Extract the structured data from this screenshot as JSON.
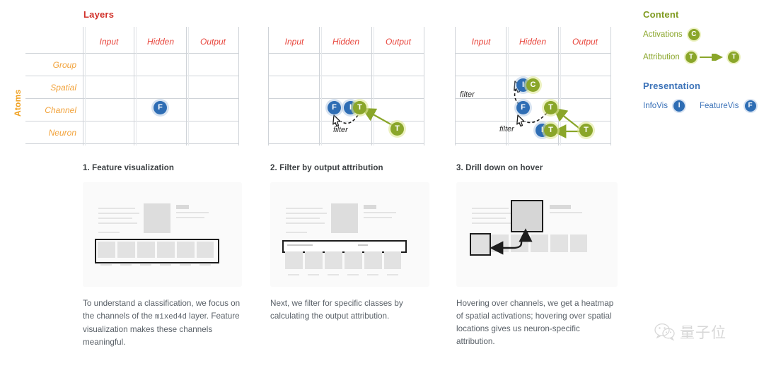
{
  "matrix": {
    "layers_title": "Layers",
    "atoms_title": "Atoms",
    "columns": [
      "Input",
      "Hidden",
      "Output"
    ],
    "rows": [
      "Group",
      "Spatial",
      "Channel",
      "Neuron"
    ],
    "filter_label": "filter"
  },
  "panel1": {
    "badges": [
      {
        "letter": "F",
        "kind": "blue",
        "row": "Channel",
        "col": "Hidden"
      }
    ]
  },
  "panel2": {
    "badges": [
      {
        "letter": "F",
        "kind": "blue",
        "row": "Channel",
        "col": "Hidden"
      },
      {
        "letter": "I",
        "kind": "blue",
        "row": "Channel",
        "col": "Hidden"
      },
      {
        "letter": "T",
        "kind": "green",
        "row": "Channel",
        "col": "Hidden"
      },
      {
        "letter": "T",
        "kind": "green",
        "row": "Neuron",
        "col": "Output"
      }
    ],
    "filter_label": "filter"
  },
  "panel3": {
    "badges": [
      {
        "letter": "I",
        "kind": "blue",
        "row": "Spatial",
        "col": "Hidden"
      },
      {
        "letter": "C",
        "kind": "green",
        "row": "Spatial",
        "col": "Hidden"
      },
      {
        "letter": "F",
        "kind": "blue",
        "row": "Channel",
        "col": "Hidden"
      },
      {
        "letter": "T",
        "kind": "green",
        "row": "Channel",
        "col": "Output"
      },
      {
        "letter": "I",
        "kind": "blue",
        "row": "Neuron",
        "col": "Output"
      },
      {
        "letter": "T",
        "kind": "green",
        "row": "Neuron",
        "col": "Output"
      },
      {
        "letter": "T",
        "kind": "green",
        "row": "Neuron",
        "col": "Output"
      }
    ],
    "filter_label_top": "filter",
    "filter_label_bottom": "filter"
  },
  "legend": {
    "content_heading": "Content",
    "activations_label": "Activations",
    "activations_badge": "C",
    "attribution_label": "Attribution",
    "attribution_badge_from": "T",
    "attribution_badge_to": "T",
    "presentation_heading": "Presentation",
    "infovis_label": "InfoVis",
    "infovis_badge": "I",
    "featurevis_label": "FeatureVis",
    "featurevis_badge": "F"
  },
  "steps": [
    {
      "title": "1. Feature visualization",
      "caption_part1": "To understand a classification, we focus on the channels of the ",
      "caption_mono": "mixed4d",
      "caption_part2": " layer. Feature visualization makes these channels meaningful."
    },
    {
      "title": "2. Filter by output attribution",
      "caption_part1": "Next, we filter for specific classes by calculating the output attribution.",
      "caption_mono": "",
      "caption_part2": ""
    },
    {
      "title": "3. Drill down on hover",
      "caption_part1": "Hovering over channels, we get a heatmap of spatial activations; hovering over spatial locations gives us neuron-specific attribution.",
      "caption_mono": "",
      "caption_part2": ""
    }
  ],
  "watermark": {
    "text": "量子位",
    "icon": "wechat-icon"
  },
  "colors": {
    "red": "#e8453c",
    "orange": "#f2a33c",
    "blue": "#2e6db4",
    "olive": "#8aa62a",
    "grid_line": "#cfd3d8"
  }
}
